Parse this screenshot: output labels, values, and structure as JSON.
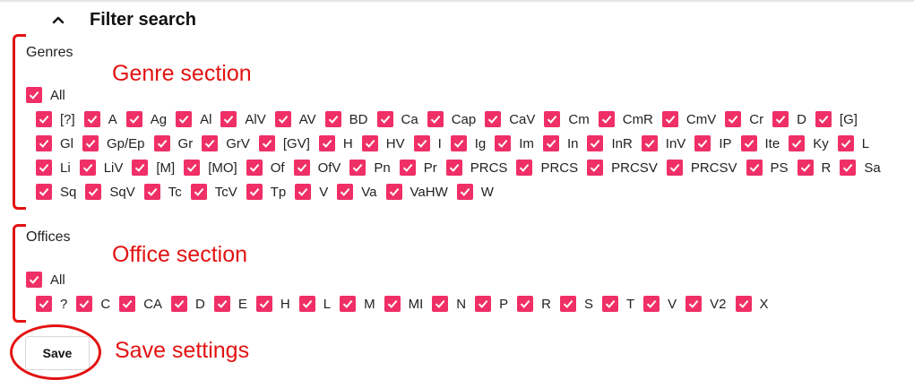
{
  "header": {
    "title": "Filter search",
    "toggle_icon": "chevron-up-icon"
  },
  "genres": {
    "label": "Genres",
    "all_label": "All",
    "rows": [
      [
        "[?]",
        "A",
        "Ag",
        "Al",
        "AlV",
        "AV",
        "BD",
        "Ca",
        "Cap",
        "CaV",
        "Cm",
        "CmR",
        "CmV",
        "Cr",
        "D",
        "[G]"
      ],
      [
        "Gl",
        "Gp/Ep",
        "Gr",
        "GrV",
        "[GV]",
        "H",
        "HV",
        "I",
        "Ig",
        "Im",
        "In",
        "InR",
        "InV",
        "IP",
        "Ite",
        "Ky",
        "L"
      ],
      [
        "Li",
        "LiV",
        "[M]",
        "[MO]",
        "Of",
        "OfV",
        "Pn",
        "Pr",
        "PRCS",
        "PRCS",
        "PRCSV",
        "PRCSV",
        "PS",
        "R",
        "Sa"
      ],
      [
        "Sq",
        "SqV",
        "Tc",
        "TcV",
        "Tp",
        "V",
        "Va",
        "VaHW",
        "W"
      ]
    ]
  },
  "offices": {
    "label": "Offices",
    "all_label": "All",
    "items": [
      "?",
      "C",
      "CA",
      "D",
      "E",
      "H",
      "L",
      "M",
      "MI",
      "N",
      "P",
      "R",
      "S",
      "T",
      "V",
      "V2",
      "X"
    ]
  },
  "save_label": "Save",
  "annotations": {
    "genre": "Genre section",
    "office": "Office section",
    "save": "Save settings",
    "color": "#e31212"
  },
  "colors": {
    "checkbox": "#ef2f66",
    "check": "#ffffff"
  }
}
